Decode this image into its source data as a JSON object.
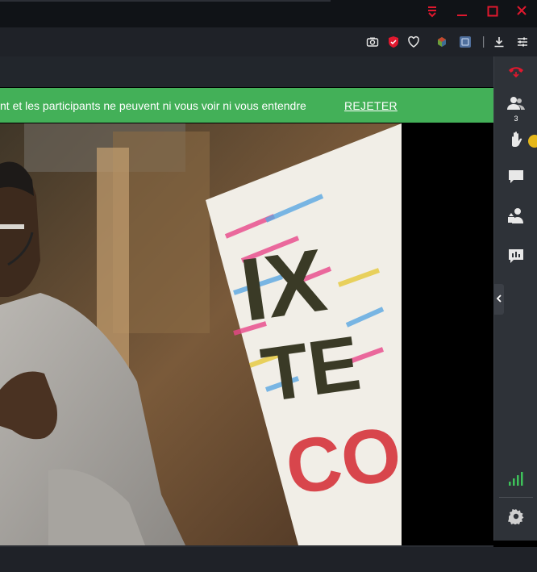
{
  "banner": {
    "message": "nt et les participants ne peuvent ni vous voir ni vous entendre",
    "reject_label": "REJETER"
  },
  "sidebar": {
    "participants_count": "3"
  },
  "video": {
    "sign_line1": "IX",
    "sign_line2": "TE",
    "sign_line3": "CO"
  },
  "colors": {
    "banner_green": "#43b058",
    "window_control_red": "#e0182e",
    "hangup_red": "#e0182e",
    "signal_green": "#3ec25a",
    "hand_raise_yellow": "#e5b719"
  },
  "icons": [
    "minimize-icon",
    "maximize-icon",
    "close-icon",
    "camera-icon",
    "shield-icon",
    "heart-icon",
    "cube-icon",
    "extension-icon",
    "download-icon",
    "settings-sliders-icon",
    "hangup-icon",
    "participants-icon",
    "raise-hand-icon",
    "chat-icon",
    "share-icon",
    "poll-icon",
    "signal-icon",
    "gear-icon",
    "chevron-left-icon"
  ]
}
